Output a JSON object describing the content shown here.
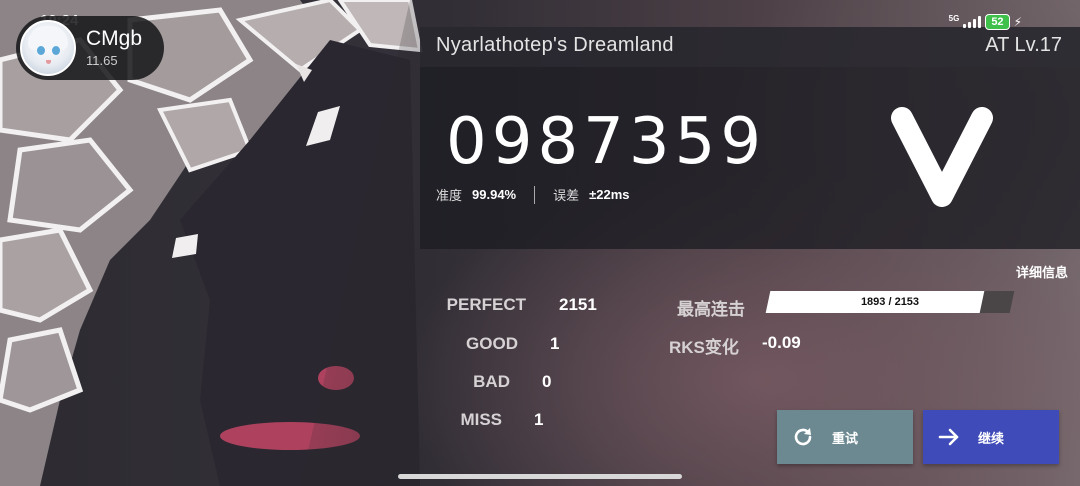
{
  "status_bar": {
    "time": "10:24",
    "network": "5G",
    "battery": "52"
  },
  "player": {
    "name": "CMgb",
    "rks": "11.65"
  },
  "song": {
    "title": "Nyarlathotep's Dreamland",
    "difficulty": "AT Lv.17"
  },
  "score": {
    "value": "0987359",
    "rank": "V"
  },
  "accuracy": {
    "label": "准度",
    "value": "99.94%"
  },
  "offset": {
    "label": "误差",
    "value": "±22ms"
  },
  "judgements": {
    "perfect": {
      "label": "PERFECT",
      "value": "2151"
    },
    "good": {
      "label": "GOOD",
      "value": "1"
    },
    "bad": {
      "label": "BAD",
      "value": "0"
    },
    "miss": {
      "label": "MISS",
      "value": "1"
    }
  },
  "max_combo": {
    "label": "最高连击",
    "text": "1893 / 2153",
    "fraction": 0.878
  },
  "rks_change": {
    "label": "RKS变化",
    "value": "-0.09"
  },
  "details_link": "详细信息",
  "buttons": {
    "retry": "重试",
    "continue": "继续"
  },
  "colors": {
    "retry_bg": "#6c8890",
    "continue_bg": "#3e4bb8",
    "battery": "#3ec04a"
  }
}
